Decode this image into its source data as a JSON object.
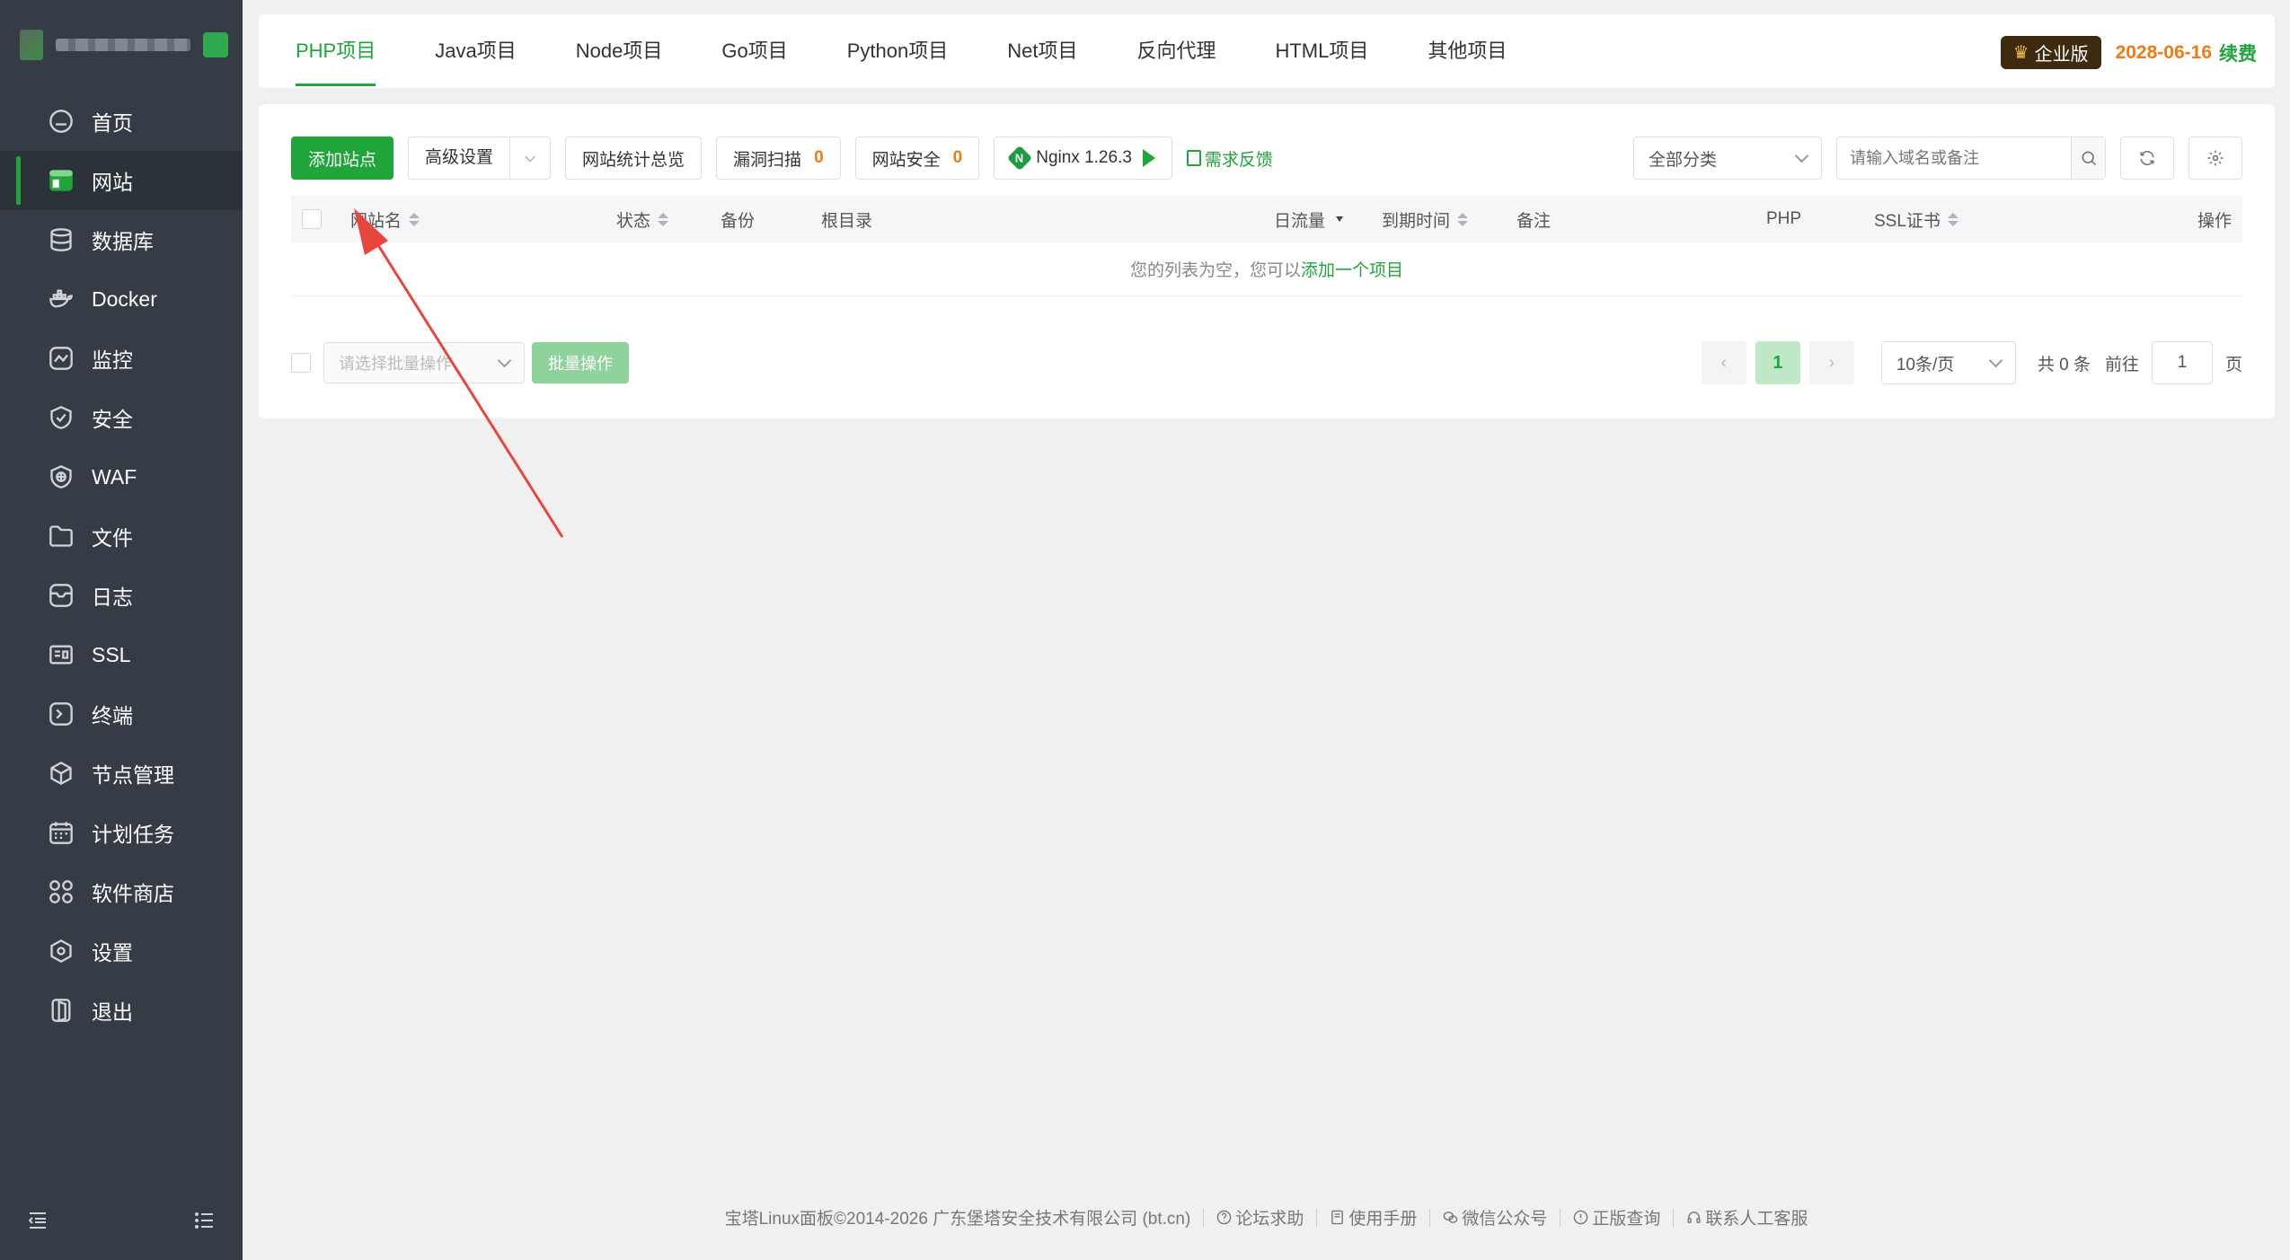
{
  "sidebar": {
    "items": [
      {
        "label": "首页",
        "icon": "home-icon"
      },
      {
        "label": "网站",
        "icon": "website-icon",
        "active": true
      },
      {
        "label": "数据库",
        "icon": "database-icon"
      },
      {
        "label": "Docker",
        "icon": "docker-icon"
      },
      {
        "label": "监控",
        "icon": "monitor-icon"
      },
      {
        "label": "安全",
        "icon": "shield-icon"
      },
      {
        "label": "WAF",
        "icon": "waf-icon"
      },
      {
        "label": "文件",
        "icon": "folder-icon"
      },
      {
        "label": "日志",
        "icon": "log-icon"
      },
      {
        "label": "SSL",
        "icon": "ssl-icon"
      },
      {
        "label": "终端",
        "icon": "terminal-icon"
      },
      {
        "label": "节点管理",
        "icon": "node-icon"
      },
      {
        "label": "计划任务",
        "icon": "calendar-icon"
      },
      {
        "label": "软件商店",
        "icon": "apps-icon"
      },
      {
        "label": "设置",
        "icon": "settings-icon"
      },
      {
        "label": "退出",
        "icon": "logout-icon"
      }
    ]
  },
  "tabs": [
    "PHP项目",
    "Java项目",
    "Node项目",
    "Go项目",
    "Python项目",
    "Net项目",
    "反向代理",
    "HTML项目",
    "其他项目"
  ],
  "enterprise": {
    "badge": "企业版",
    "expiry": "2028-06-16",
    "renew": "续费"
  },
  "toolbar": {
    "add_site": "添加站点",
    "advanced": "高级设置",
    "stats": "网站统计总览",
    "vuln_scan": "漏洞扫描",
    "vuln_count": "0",
    "site_security": "网站安全",
    "security_count": "0",
    "nginx": "Nginx 1.26.3",
    "nginx_logo": "N",
    "feedback": "需求反馈",
    "category": "全部分类",
    "search_placeholder": "请输入域名或备注"
  },
  "table": {
    "headers": {
      "name": "网站名",
      "status": "状态",
      "backup": "备份",
      "root": "根目录",
      "traffic": "日流量",
      "expiry": "到期时间",
      "remark": "备注",
      "php": "PHP",
      "ssl": "SSL证书",
      "action": "操作"
    },
    "empty_text": "您的列表为空，您可以",
    "empty_link": "添加一个项目"
  },
  "bulk": {
    "placeholder": "请选择批量操作",
    "button": "批量操作"
  },
  "pager": {
    "prev": "‹",
    "current": "1",
    "next": "›",
    "page_size": "10条/页",
    "total": "共 0 条",
    "goto_label": "前往",
    "goto_value": "1",
    "page_unit": "页"
  },
  "footer": {
    "copyright": "宝塔Linux面板©2014-2026 广东堡塔安全技术有限公司 (bt.cn)",
    "links": [
      "论坛求助",
      "使用手册",
      "微信公众号",
      "正版查询",
      "联系人工客服"
    ]
  },
  "colors": {
    "accent": "#20a53a",
    "sidebar_bg": "#363c45",
    "warning": "#f07a14",
    "annotation": "#e8453c"
  }
}
